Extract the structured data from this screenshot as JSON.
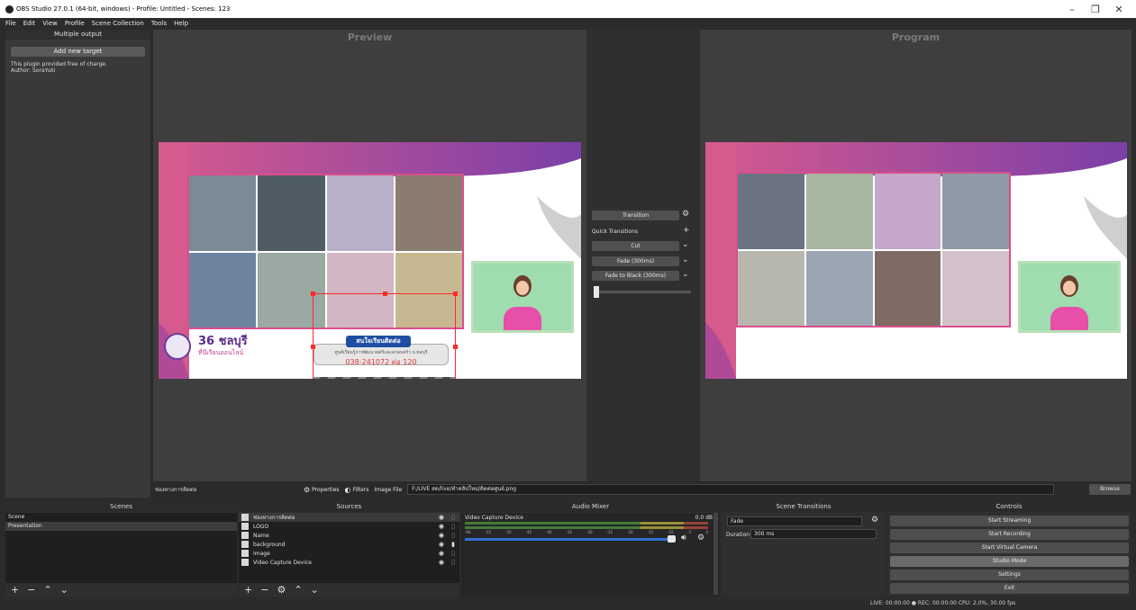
{
  "window": {
    "title": "OBS Studio 27.0.1 (64-bit, windows) - Profile: Untitled - Scenes: 123",
    "controls": [
      "–",
      "❐",
      "✕"
    ]
  },
  "menu": [
    "File",
    "Edit",
    "View",
    "Profile",
    "Scene Collection",
    "Tools",
    "Help"
  ],
  "multiple_output": {
    "title": "Multiple output",
    "add_label": "Add new target",
    "note_line1": "This plugin provided free of charge.",
    "note_line2": "Author: SoraYuki"
  },
  "preview": {
    "title": "Preview",
    "logo_number": "36 ชลบุรี",
    "logo_tagline": "ที่นี่เรียนออนไลน์",
    "contact_badge": "สนใจเรียนติดต่อ",
    "contact_line1": "ศูนย์เรียนรู้การพัฒนาสตรีและครอบครัว จ.ชลบุรี",
    "contact_phone": "038-241072 ต่อ 120"
  },
  "program": {
    "title": "Program"
  },
  "transitions_panel": {
    "transition_label": "Transition",
    "quick_label": "Quick Transitions",
    "cut": "Cut",
    "fade": "Fade (300ms)",
    "fade_black": "Fade to Black (300ms)"
  },
  "source_toolbar": {
    "selected_source": "ช่องทางการติดต่อ",
    "properties": "Properties",
    "filters": "Filters",
    "image_file_label": "Image File",
    "path": "F:/LIVE สด/live/ทำคลิปใหม่/ติดต่อศูนย์.png",
    "browse": "Browse"
  },
  "scenes": {
    "title": "Scenes",
    "items": [
      "Scene",
      "Presentation"
    ]
  },
  "sources": {
    "title": "Sources",
    "items": [
      "ช่องทางการติดต่อ",
      "LOGO",
      "Name",
      "background",
      "Image",
      "Video Capture Device"
    ]
  },
  "audio_mixer": {
    "title": "Audio Mixer",
    "device": "Video Capture Device",
    "db": "0.0 dB",
    "ticks": [
      "-60",
      "-55",
      "-50",
      "-45",
      "-40",
      "-35",
      "-30",
      "-25",
      "-20",
      "-15",
      "-10",
      "-5",
      "0"
    ]
  },
  "scene_transitions": {
    "title": "Scene Transitions",
    "selected": "Fade",
    "duration_label": "Duration",
    "duration_value": "300 ms"
  },
  "controls": {
    "title": "Controls",
    "start_streaming": "Start Streaming",
    "start_recording": "Start Recording",
    "start_virtual_camera": "Start Virtual Camera",
    "studio_mode": "Studio Mode",
    "settings": "Settings",
    "exit": "Exit"
  },
  "status": {
    "text": "LIVE: 00:00:00   ●  REC: 00:00:00     CPU: 2.0%, 30.00 fps"
  },
  "colors": {
    "accent_pink": "#c94b8c",
    "accent_purple": "#7a3fa8",
    "selection_red": "#ff2a2a",
    "volume_blue": "#2f6fd1"
  }
}
